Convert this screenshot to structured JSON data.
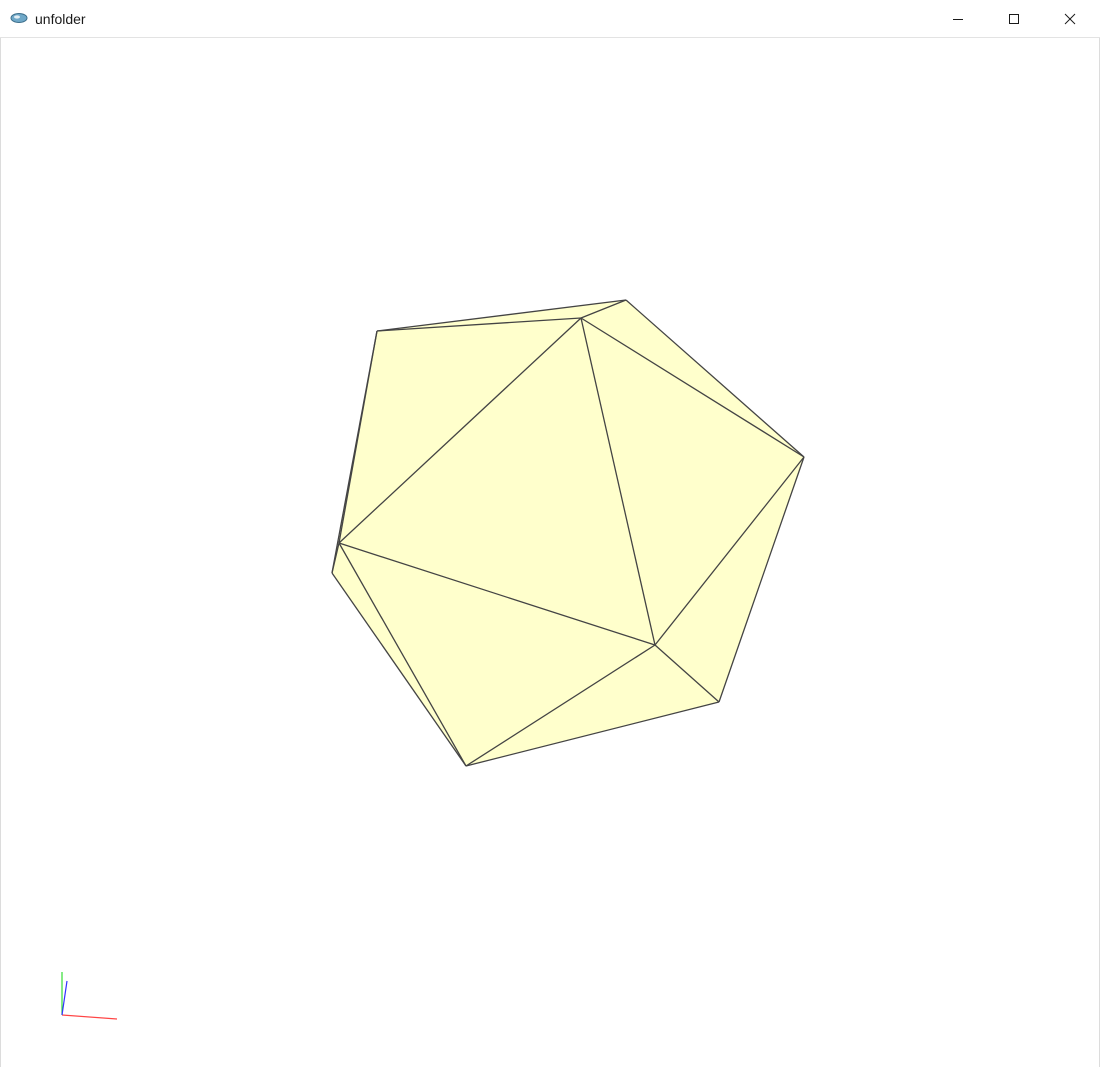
{
  "window": {
    "title": "unfolder",
    "app_icon": "app-icon",
    "controls": {
      "minimize_icon": "minimize-icon",
      "maximize_icon": "maximize-icon",
      "close_icon": "close-icon"
    }
  },
  "viewport": {
    "background_color": "#ffffff",
    "mesh": {
      "shape": "icosahedron",
      "face_color": "#ffffcc",
      "edge_color": "#444444"
    },
    "axes_gizmo": {
      "x_color": "#ff4444",
      "y_color": "#33dd33",
      "z_color": "#3333ff"
    }
  }
}
